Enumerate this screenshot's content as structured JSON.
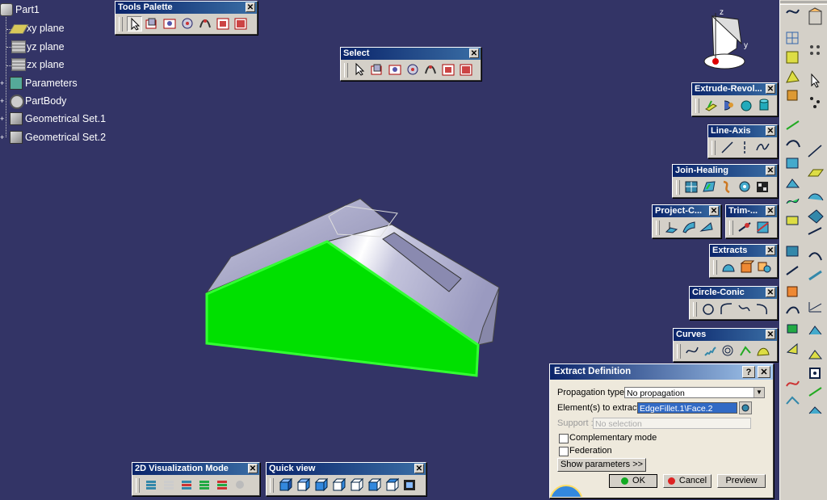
{
  "spec_tree": {
    "root": "Part1",
    "items": [
      {
        "label": "xy plane",
        "icon": "plane-icon"
      },
      {
        "label": "yz plane",
        "icon": "plane-icon"
      },
      {
        "label": "zx plane",
        "icon": "plane-icon"
      },
      {
        "label": "Parameters",
        "icon": "parameters-icon"
      },
      {
        "label": "PartBody",
        "icon": "body-icon"
      },
      {
        "label": "Geometrical Set.1",
        "icon": "geometrical-set-icon"
      },
      {
        "label": "Geometrical Set.2",
        "icon": "geometrical-set-icon"
      }
    ]
  },
  "toolbars": {
    "tools_palette": "Tools Palette",
    "select": "Select",
    "extrude": "Extrude-Revol...",
    "line_axis": "Line-Axis",
    "join_healing": "Join-Healing",
    "project": "Project-C...",
    "trim": "Trim-...",
    "extracts": "Extracts",
    "circle_conic": "Circle-Conic",
    "curves": "Curves",
    "viz_mode": "2D Visualization Mode",
    "quick_view": "Quick view"
  },
  "close_glyph": "✕",
  "dialog": {
    "title": "Extract Definition",
    "help_glyph": "?",
    "propagation_label": "Propagation type:",
    "propagation_value": "No propagation",
    "elements_label": "Element(s) to extract:",
    "elements_value": "EdgeFillet.1\\Face.2",
    "support_label": "Support :",
    "support_value": "No selection",
    "complementary_label": "Complementary mode",
    "federation_label": "Federation",
    "show_params": "Show parameters >>",
    "ok": "OK",
    "cancel": "Cancel",
    "preview": "Preview"
  },
  "compass": {
    "z": "z",
    "y": "y"
  },
  "colors": {
    "background": "#333466",
    "highlight": "#00e000",
    "title_bar": "#0a246a"
  }
}
